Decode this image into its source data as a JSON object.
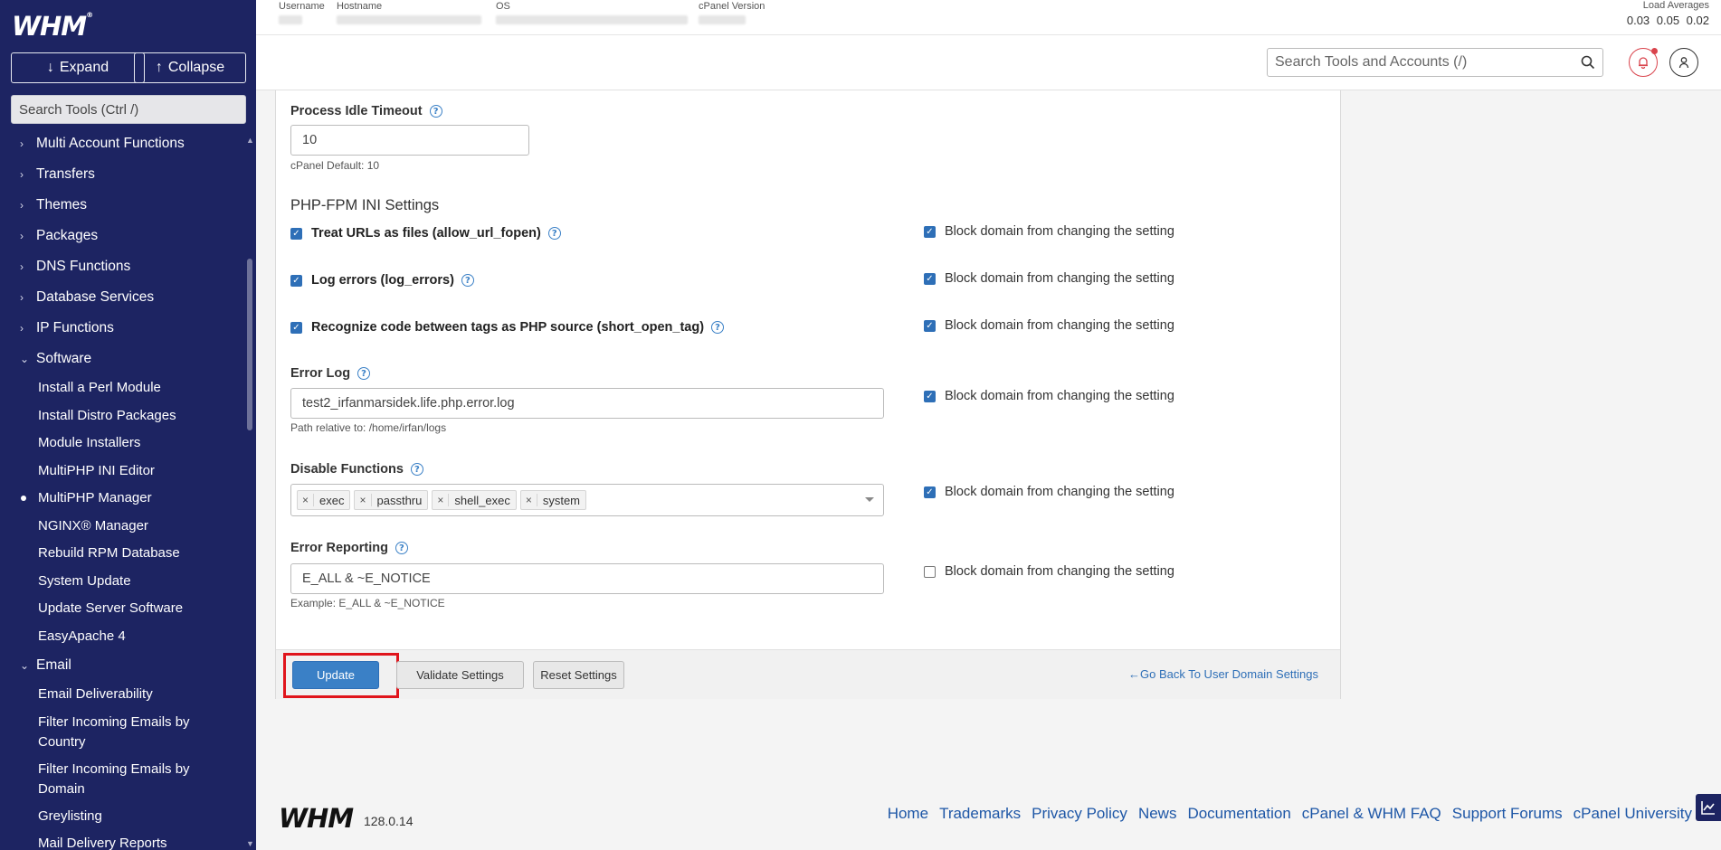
{
  "sidebar": {
    "logo": "WHM",
    "expand_label": "Expand",
    "collapse_label": "Collapse",
    "search_placeholder": "Search Tools (Ctrl /)",
    "categories": [
      {
        "label": "Multi Account Functions"
      },
      {
        "label": "Transfers"
      },
      {
        "label": "Themes"
      },
      {
        "label": "Packages"
      },
      {
        "label": "DNS Functions"
      },
      {
        "label": "Database Services"
      },
      {
        "label": "IP Functions"
      },
      {
        "label": "Software"
      },
      {
        "label": "Email"
      }
    ],
    "software_items": [
      "Install a Perl Module",
      "Install Distro Packages",
      "Module Installers",
      "MultiPHP INI Editor",
      "MultiPHP Manager",
      "NGINX® Manager",
      "Rebuild RPM Database",
      "System Update",
      "Update Server Software",
      "EasyApache 4"
    ],
    "email_items": [
      "Email Deliverability",
      "Filter Incoming Emails by Country",
      "Filter Incoming Emails by Domain",
      "Greylisting",
      "Mail Delivery Reports"
    ]
  },
  "topbar": {
    "username_label": "Username",
    "hostname_label": "Hostname",
    "os_label": "OS",
    "cpanel_version_label": "cPanel Version",
    "load_label": "Load Averages",
    "load_values": "0.03 0.05 0.02",
    "search_placeholder": "Search Tools and Accounts (/)"
  },
  "form": {
    "idle_timeout_label": "Process Idle Timeout",
    "idle_timeout_value": "10",
    "idle_timeout_hint": "cPanel Default: 10",
    "section_title": "PHP-FPM INI Settings",
    "allow_url_fopen_label": "Treat URLs as files (allow_url_fopen)",
    "log_errors_label": "Log errors (log_errors)",
    "short_open_tag_label": "Recognize code between tags as PHP source (short_open_tag)",
    "block_label": "Block domain from changing the setting",
    "error_log_label": "Error Log",
    "error_log_value": "test2_irfanmarsidek.life.php.error.log",
    "error_log_hint": "Path relative to: /home/irfan/logs",
    "disable_functions_label": "Disable Functions",
    "disabled_functions": [
      "exec",
      "passthru",
      "shell_exec",
      "system"
    ],
    "error_reporting_label": "Error Reporting",
    "error_reporting_value": "E_ALL & ~E_NOTICE",
    "error_reporting_hint": "Example: E_ALL & ~E_NOTICE"
  },
  "actions": {
    "update_label": "Update",
    "validate_label": "Validate Settings",
    "reset_label": "Reset Settings",
    "back_label": "Go Back To User Domain Settings"
  },
  "footer": {
    "logo": "WHM",
    "version": "128.0.14",
    "links": [
      "Home",
      "Trademarks",
      "Privacy Policy",
      "News",
      "Documentation",
      "cPanel & WHM FAQ",
      "Support Forums",
      "cPanel University"
    ]
  }
}
